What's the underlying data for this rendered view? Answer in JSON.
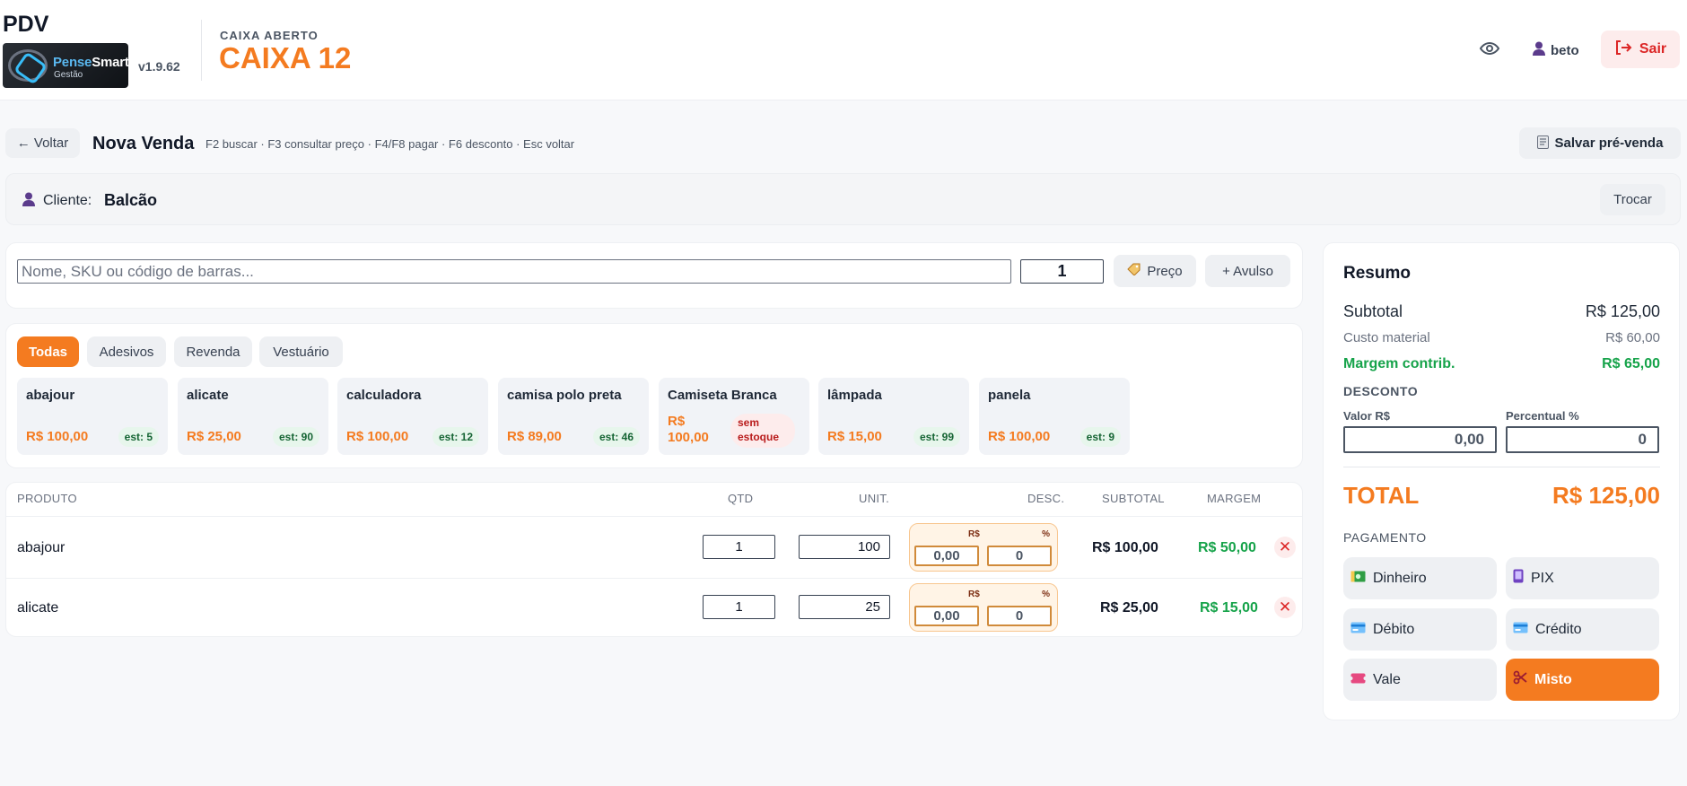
{
  "app": {
    "title": "PDV",
    "logo_text_a": "Pense",
    "logo_text_b": "Smart",
    "logo_text_c": "Gestão",
    "version": "v1.9.62",
    "caixa_status": "CAIXA ABERTO",
    "caixa_name": "CAIXA 12",
    "user": "beto",
    "logout_label": "Sair",
    "accent": "#f47b20"
  },
  "toolbar": {
    "back_label": "← Voltar",
    "title": "Nova Venda",
    "hotkeys": "F2 buscar · F3 consultar preço · F4/F8 pagar · F6 desconto · Esc voltar",
    "save_label": "Salvar pré-venda"
  },
  "cliente": {
    "label": "Cliente:",
    "name": "Balcão",
    "change_label": "Trocar"
  },
  "search": {
    "placeholder": "Nome, SKU ou código de barras...",
    "qty": "1",
    "price_label": "Preço",
    "avulso_label": "+ Avulso"
  },
  "categories": [
    "Todas",
    "Adesivos",
    "Revenda",
    "Vestuário"
  ],
  "products": [
    {
      "name": "abajour",
      "price": "R$ 100,00",
      "stock": "est: 5"
    },
    {
      "name": "alicate",
      "price": "R$ 25,00",
      "stock": "est: 90"
    },
    {
      "name": "calculadora",
      "price": "R$ 100,00",
      "stock": "est: 12"
    },
    {
      "name": "camisa polo preta",
      "price": "R$ 89,00",
      "stock": "est: 46"
    },
    {
      "name": "Camiseta Branca",
      "price": "R$ 100,00",
      "stock": "sem estoque"
    },
    {
      "name": "lâmpada",
      "price": "R$ 15,00",
      "stock": "est: 99"
    },
    {
      "name": "panela",
      "price": "R$ 100,00",
      "stock": "est: 9"
    }
  ],
  "cart": {
    "headers": {
      "produto": "PRODUTO",
      "qtd": "QTD",
      "unit": "UNIT.",
      "desc": "DESC.",
      "subtotal": "SUBTOTAL",
      "margem": "MARGEM"
    },
    "desc_currency_label": "R$",
    "desc_percent_label": "%",
    "rows": [
      {
        "name": "abajour",
        "qty": "1",
        "unit": "100",
        "desc_value": "0,00",
        "desc_percent": "0",
        "subtotal": "R$ 100,00",
        "margem": "R$ 50,00"
      },
      {
        "name": "alicate",
        "qty": "1",
        "unit": "25",
        "desc_value": "0,00",
        "desc_percent": "0",
        "subtotal": "R$ 25,00",
        "margem": "R$ 15,00"
      }
    ]
  },
  "resumo": {
    "title": "Resumo",
    "subtotal_label": "Subtotal",
    "subtotal_value": "R$ 125,00",
    "custo_label": "Custo material",
    "custo_value": "R$ 60,00",
    "margem_label": "Margem contrib.",
    "margem_value": "R$ 65,00",
    "desconto_label": "DESCONTO",
    "valor_label": "Valor R$",
    "valor_value": "0,00",
    "percent_label": "Percentual %",
    "percent_value": "0",
    "total_label": "TOTAL",
    "total_value": "R$ 125,00",
    "pagamento_label": "PAGAMENTO",
    "payments": [
      "Dinheiro",
      "PIX",
      "Débito",
      "Crédito",
      "Vale",
      "Misto"
    ]
  }
}
